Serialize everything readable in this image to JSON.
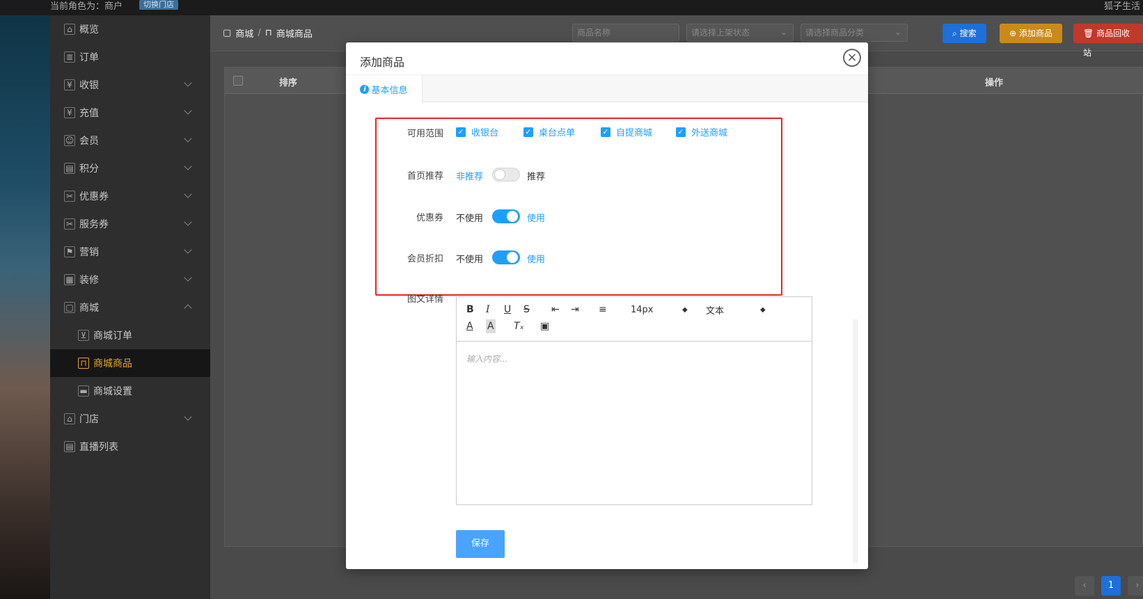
{
  "topbar": {
    "role": "当前角色为：商户",
    "switch_label": "切换门店",
    "user": "狐子生活"
  },
  "sidebar": {
    "items": [
      {
        "label": "概览",
        "icon": "home-icon",
        "glyph": "⌂",
        "chev": ""
      },
      {
        "label": "订单",
        "icon": "order-icon",
        "glyph": "≣",
        "chev": ""
      },
      {
        "label": "收银",
        "icon": "cashier-icon",
        "glyph": "¥",
        "chev": "down"
      },
      {
        "label": "充值",
        "icon": "recharge-icon",
        "glyph": "¥",
        "chev": "down"
      },
      {
        "label": "会员",
        "icon": "member-icon",
        "glyph": "☺",
        "chev": "down"
      },
      {
        "label": "积分",
        "icon": "points-icon",
        "glyph": "▤",
        "chev": "down"
      },
      {
        "label": "优惠券",
        "icon": "coupon-icon",
        "glyph": "✂",
        "chev": "down"
      },
      {
        "label": "服务券",
        "icon": "service-coupon-icon",
        "glyph": "✂",
        "chev": "down"
      },
      {
        "label": "营销",
        "icon": "marketing-icon",
        "glyph": "⚑",
        "chev": "down"
      },
      {
        "label": "装修",
        "icon": "decorate-icon",
        "glyph": "▦",
        "chev": "down"
      },
      {
        "label": "商城",
        "icon": "mall-icon",
        "glyph": "▢",
        "chev": "up"
      },
      {
        "label": "商城订单",
        "icon": "cart-icon",
        "glyph": "⊻",
        "chev": "",
        "sub": true
      },
      {
        "label": "商城商品",
        "icon": "bag-icon",
        "glyph": "⊓",
        "chev": "",
        "sub": true,
        "active": true
      },
      {
        "label": "商城设置",
        "icon": "settings-icon",
        "glyph": "▬",
        "chev": "",
        "sub": true
      },
      {
        "label": "门店",
        "icon": "store-icon",
        "glyph": "⌂",
        "chev": "down"
      },
      {
        "label": "直播列表",
        "icon": "live-icon",
        "glyph": "▤",
        "chev": ""
      }
    ]
  },
  "breadcrumb": {
    "level1": "商城",
    "level2": "商城商品"
  },
  "filters": {
    "name_placeholder": "商品名称",
    "status_placeholder": "请选择上架状态",
    "category_placeholder": "请选择商品分类"
  },
  "buttons": {
    "search": "搜索",
    "add": "添加商品",
    "recycle": "商品回收站"
  },
  "colors": {
    "search": "#1e6fd9",
    "add": "#c98a1b",
    "recycle": "#c0392b",
    "accent": "#1e9fff",
    "active_nav": "#e8a427"
  },
  "table": {
    "col_sort": "排序",
    "col_action": "操作"
  },
  "pager": {
    "prev": "‹",
    "current": "1",
    "next": "›"
  },
  "modal": {
    "title": "添加商品",
    "close": "×",
    "tab": "基本信息",
    "scope_label": "可用范围",
    "scope_options": [
      "收银台",
      "桌台点单",
      "自提商城",
      "外送商城"
    ],
    "recommend_label": "首页推荐",
    "recommend_off": "非推荐",
    "recommend_on": "推荐",
    "recommend_enabled": false,
    "coupon_label": "优惠券",
    "coupon_off": "不使用",
    "coupon_on": "使用",
    "coupon_enabled": true,
    "member_label": "会员折扣",
    "member_off": "不使用",
    "member_on": "使用",
    "member_enabled": true,
    "detail_label": "图文详情",
    "editor": {
      "font_size": "14px",
      "block_type": "文本",
      "placeholder": "输入内容..."
    },
    "save": "保存"
  }
}
